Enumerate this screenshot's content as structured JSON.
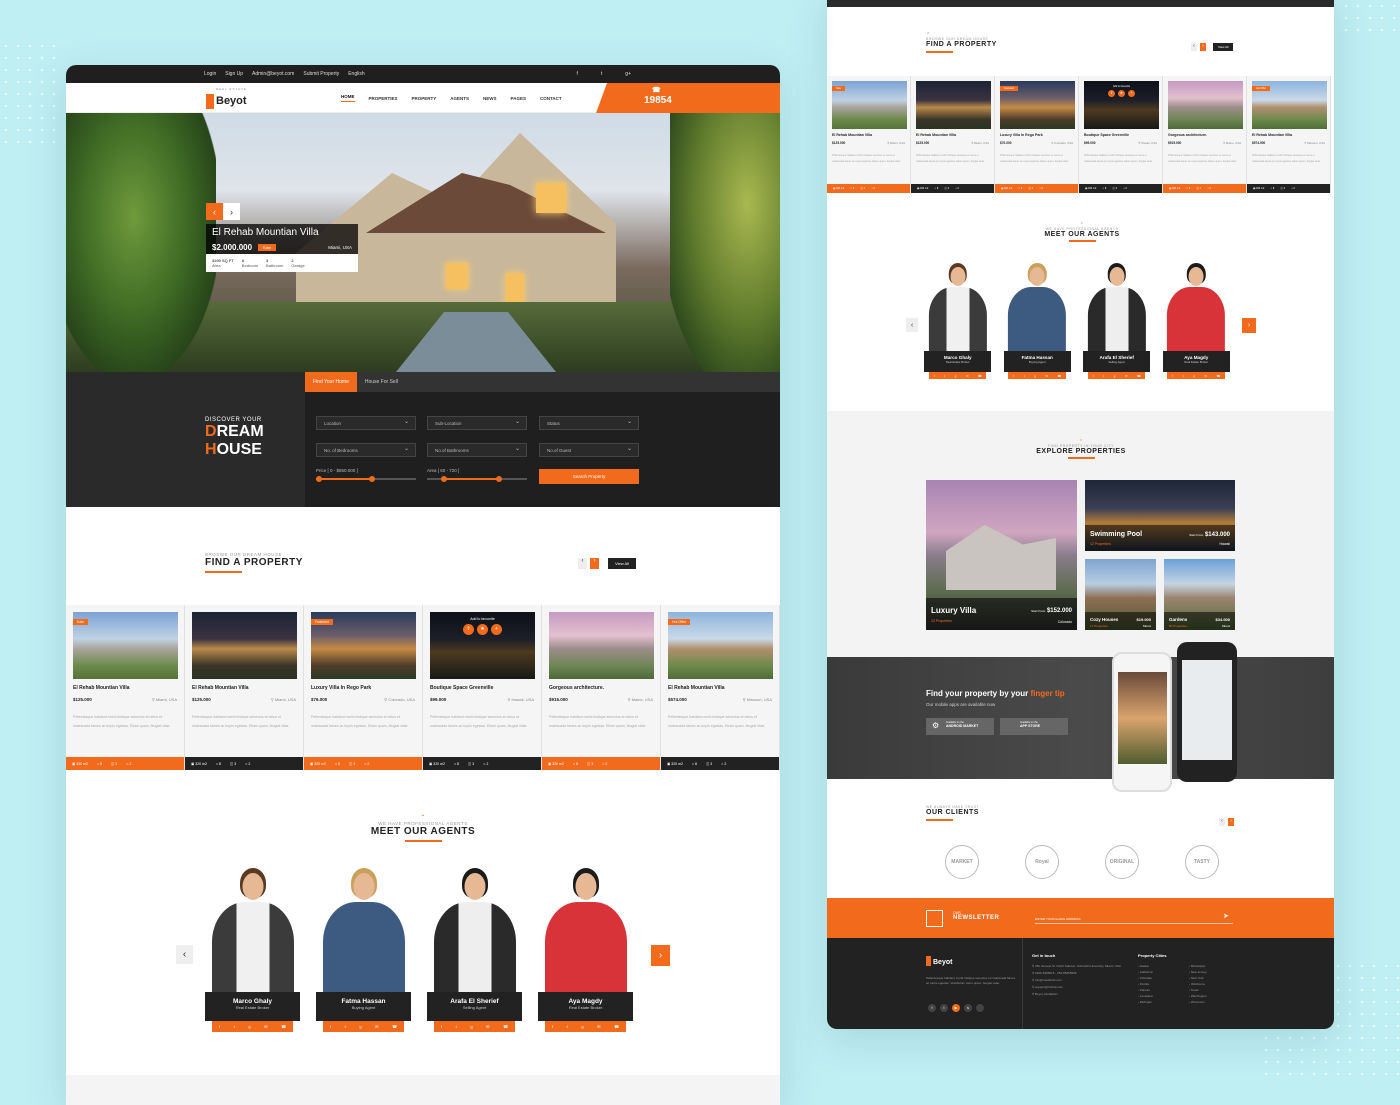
{
  "left": {
    "topbar": {
      "items": [
        "Login",
        "Sign Up",
        "Admin@beyot.com",
        "Submit Property",
        "English"
      ],
      "social": [
        "f",
        "t",
        "g+"
      ]
    },
    "logo": {
      "name": "Beyot",
      "tagline": "REAL ESTATE"
    },
    "menu": [
      "HOME",
      "PROPERTIES",
      "PROPERTY",
      "AGENTS",
      "NEWS",
      "PAGES",
      "CONTACT"
    ],
    "phone": "19854",
    "hero": {
      "title": "El Rehab Mountian Villa",
      "price": "$2.000.000",
      "tag": "Sale",
      "location": "Miami, USA",
      "specs": [
        {
          "value": "3200 SQ FT",
          "label": "Area"
        },
        {
          "value": "8",
          "label": "Bedroom"
        },
        {
          "value": "3",
          "label": "Bathroom"
        },
        {
          "value": "2",
          "label": "Garage"
        }
      ]
    },
    "search": {
      "discover": "DISCOVER YOUR",
      "dream": "DREAM",
      "house": "HOUSE",
      "tabs": [
        "Find Your Home",
        "House For Sell"
      ],
      "selects": [
        "Location",
        "Sub-Location",
        "Status",
        "No. of Bedrooms",
        "No.of Bathrooms",
        "No.of Guest"
      ],
      "price_label": "Price",
      "price_range": "[ 0 - $850.000 ]",
      "area_label": "Area",
      "area_range": "[ 60 - 720 ]",
      "button": "Search Property"
    },
    "find": {
      "sub": "BROSWE OUR DREAM HOUSE",
      "title": "FIND A PROPERTY",
      "view_all": "View All"
    },
    "properties": [
      {
        "title": "El Rehab Mountian Villa",
        "price": "$125.000",
        "location": "Miami, USA",
        "badge": "Sale"
      },
      {
        "title": "El Rehab Mountian Villa",
        "price": "$125.000",
        "location": "Miami, USA",
        "badge": ""
      },
      {
        "title": "Luxury Villa In Rego Park",
        "price": "$76.000",
        "location": "Colorado, USA",
        "badge": "Featured"
      },
      {
        "title": "Boutique Space Greenville",
        "price": "$99.000",
        "location": "Hawaii, USA",
        "badge": ""
      },
      {
        "title": "Gorgeous architecture.",
        "price": "$915.000",
        "location": "Maine, USA",
        "badge": ""
      },
      {
        "title": "El Rehab Mountian Villa",
        "price": "$574.000",
        "location": "Missouri, USA",
        "badge": "Hot Offer"
      }
    ],
    "add_fav": "Add to favourite",
    "desc": "Pellentesque habitant morbi tristique senectus et netus et malesuada fames ac turpis egestas. Etiam quam, feugiat vitae.",
    "foot": {
      "area": "320 m2",
      "beds": "8",
      "baths": "3",
      "garage": "2"
    },
    "agents_head": {
      "sub": "WE HAVE PROFESSIONAL AGENTS",
      "title": "MEET OUR AGENTS"
    },
    "agents": [
      {
        "name": "Marco Ghaly",
        "role": "Real Estate Broker"
      },
      {
        "name": "Fatma Hassan",
        "role": "Buying Agent"
      },
      {
        "name": "Arafa El Sherief",
        "role": "Selling Agent"
      },
      {
        "name": "Aya Magdy",
        "role": "Real Estate Broker"
      }
    ]
  },
  "right": {
    "find": {
      "sub": "BROSWE OUR DREAM HOUSE",
      "title": "FIND A PROPERTY",
      "view_all": "View All"
    },
    "properties": [
      {
        "title": "El Rehab Mountian Villa",
        "price": "$125.000",
        "location": "Miami, USA",
        "badge": "Sale"
      },
      {
        "title": "El Rehab Mountian Villa",
        "price": "$125.000",
        "location": "Miami, USA",
        "badge": ""
      },
      {
        "title": "Luxury Villa In Rego Park",
        "price": "$76.000",
        "location": "Colorado, USA",
        "badge": "Featured"
      },
      {
        "title": "Boutique Space Greenville",
        "price": "$99.000",
        "location": "Hawaii, USA",
        "badge": ""
      },
      {
        "title": "Gorgeous architecture.",
        "price": "$915.000",
        "location": "Maine, USA",
        "badge": ""
      },
      {
        "title": "El Rehab Mountian Villa",
        "price": "$574.000",
        "location": "Missouri, USA",
        "badge": "Hot Offer"
      }
    ],
    "agents_head": {
      "sub": "WE HAVE PROFESSIONAL AGENTS",
      "title": "MEET OUR AGENTS"
    },
    "agents": [
      {
        "name": "Marco Ghaly",
        "role": "Real Estate Broker"
      },
      {
        "name": "Fatma Hassan",
        "role": "Buying Agent"
      },
      {
        "name": "Arafa El Sherief",
        "role": "Selling Agent"
      },
      {
        "name": "Aya Magdy",
        "role": "Real Estate Broker"
      }
    ],
    "explore": {
      "sub": "FIND PROPERTY IN YOUR CITY",
      "title": "EXPLORE PROPERTIES",
      "tiles": [
        {
          "name": "Luxury Villa",
          "count": "23 Properties",
          "start": "Start From",
          "price": "$152.000",
          "loc": "Colorado"
        },
        {
          "name": "Swimming Pool",
          "count": "12 Properties",
          "start": "Start From",
          "price": "$143.000",
          "loc": "Hawaii"
        },
        {
          "name": "Cozy Houses",
          "count": "17 Properties",
          "price": "$19.000",
          "loc": "Miami"
        },
        {
          "name": "Gardens",
          "count": "80 Properties",
          "price": "$34.000",
          "loc": "Miami"
        }
      ]
    },
    "app": {
      "title_a": "Find your property by your ",
      "title_b": "finger tip",
      "sub": "Our mobile apps are available now",
      "android_small": "Available on the",
      "android": "ANDROID MARKET",
      "ios_small": "Available on the",
      "ios": "APP STORE"
    },
    "clients": {
      "sub": "WE ALWAYS HAVE TRUST",
      "title": "OUR CLIENTS",
      "logos": [
        "MARKET",
        "Royal",
        "ORIGINAL",
        "TASTY"
      ]
    },
    "newsletter": {
      "small": "OUR",
      "title": "NEWSLETTER",
      "placeholder": "ENTER YOUR E-MAIL ADDRESS"
    },
    "footer": {
      "brand": "Beyot",
      "about": "Pellentesque habitant morbi tristique senectus et malesuada fames ac turpis egestas. Vestibulum tortor quam, feugiat vitae.",
      "contact_title": "Get in touch",
      "contact": [
        "352 Harvest St. North Subract, Oxfordshi University, Miami, USA",
        "0226-5485015 - 254-85658956",
        "info@madethat.com",
        "support@hothat.com",
        "Beyot_Redaktion"
      ],
      "cities_title": "Property Cities",
      "cities_a": [
        "Alaska",
        "California",
        "Colorado",
        "Florida",
        "Kansas",
        "Louisiana",
        "Michigan"
      ],
      "cities_b": [
        "Mississippi",
        "New Jersey",
        "New York",
        "Oklahoma",
        "Texas",
        "Washington",
        "Wisconsin"
      ]
    }
  }
}
